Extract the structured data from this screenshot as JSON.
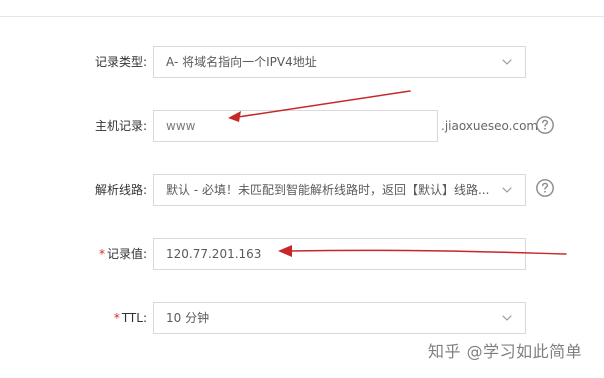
{
  "form": {
    "record_type": {
      "label": "记录类型:",
      "value": "A- 将域名指向一个IPV4地址",
      "icon": "chevron-down-icon"
    },
    "host_record": {
      "label": "主机记录:",
      "value": "www",
      "suffix": ".jiaoxueseo.com",
      "help_icon": "question-circle-icon"
    },
    "resolution_line": {
      "label": "解析线路:",
      "value": "默认 - 必填！未匹配到智能解析线路时，返回【默认】线路...",
      "icon": "chevron-down-icon",
      "help_icon": "question-circle-icon"
    },
    "record_value": {
      "required": "*",
      "label": "记录值:",
      "value": "120.77.201.163"
    },
    "ttl": {
      "required": "*",
      "label": "TTL:",
      "value": "10 分钟",
      "icon": "chevron-down-icon"
    }
  },
  "watermark": {
    "text": "知乎 @学习如此简单"
  },
  "colors": {
    "border": "#d9d9d9",
    "required": "#e0281d",
    "annotation_arrow": "#c62828",
    "text": "#333333",
    "muted_text": "#666666"
  }
}
